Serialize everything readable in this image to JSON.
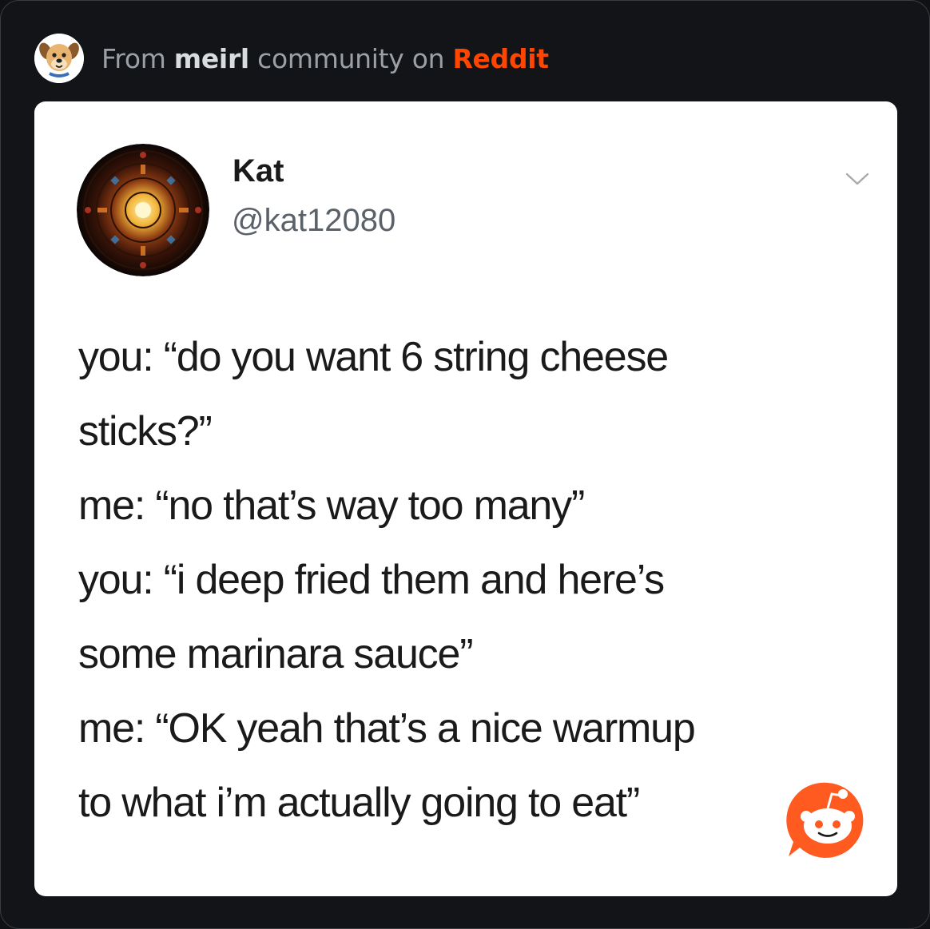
{
  "header": {
    "prefix": "From",
    "community": "meirl",
    "middle": "community on",
    "platform": "Reddit",
    "avatar_icon": "dog-mascot-icon"
  },
  "post": {
    "author_name": "Kat",
    "author_handle": "@kat12080",
    "avatar_icon": "stained-glass-avatar",
    "menu_icon": "chevron-down-icon",
    "lines": [
      "you: “do you want 6 string cheese",
      "sticks?”",
      "me: “no that’s way too many”",
      "you: “i deep fried them and here’s",
      "some marinara sauce”",
      "me: “OK yeah that’s a nice warmup",
      "to what i’m actually going to eat”"
    ]
  },
  "badge": {
    "icon": "reddit-snoo-icon"
  },
  "colors": {
    "background": "#121418",
    "card": "#ffffff",
    "brand": "#ff4500",
    "muted_text": "#9aa0a6"
  }
}
